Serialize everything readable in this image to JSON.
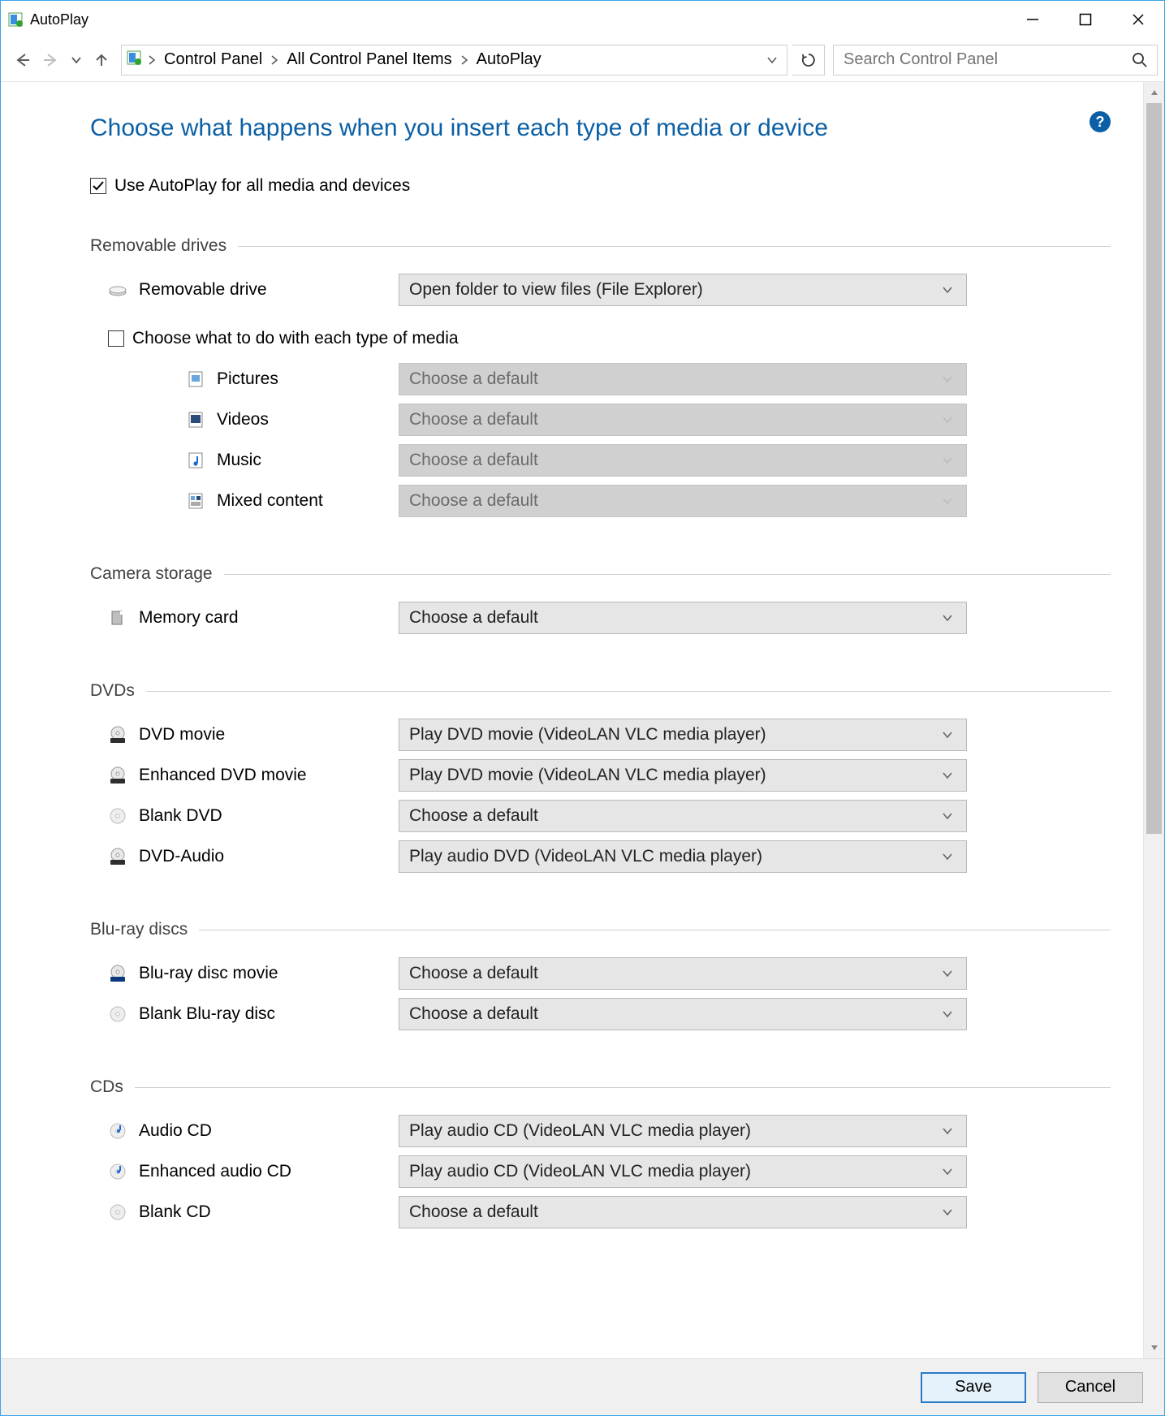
{
  "window": {
    "title": "AutoPlay"
  },
  "breadcrumb": {
    "items": [
      "Control Panel",
      "All Control Panel Items",
      "AutoPlay"
    ]
  },
  "search": {
    "placeholder": "Search Control Panel"
  },
  "page": {
    "title": "Choose what happens when you insert each type of media or device",
    "help_tooltip": "?"
  },
  "checkboxes": {
    "use_autoplay": {
      "label": "Use AutoPlay for all media and devices",
      "checked": true
    },
    "each_type": {
      "label": "Choose what to do with each type of media",
      "checked": false
    }
  },
  "dropdown_values": {
    "open_folder": "Open folder to view files (File Explorer)",
    "choose_default": "Choose a default",
    "play_dvd": "Play DVD movie (VideoLAN VLC media player)",
    "play_audio_dvd": "Play audio DVD (VideoLAN VLC media player)",
    "play_audio_cd": "Play audio CD (VideoLAN VLC media player)"
  },
  "sections": {
    "removable": {
      "title": "Removable drives",
      "main": {
        "label": "Removable drive",
        "value_key": "open_folder"
      },
      "subs": [
        {
          "label": "Pictures",
          "value_key": "choose_default",
          "disabled": true
        },
        {
          "label": "Videos",
          "value_key": "choose_default",
          "disabled": true
        },
        {
          "label": "Music",
          "value_key": "choose_default",
          "disabled": true
        },
        {
          "label": "Mixed content",
          "value_key": "choose_default",
          "disabled": true
        }
      ]
    },
    "camera": {
      "title": "Camera storage",
      "items": [
        {
          "label": "Memory card",
          "value_key": "choose_default"
        }
      ]
    },
    "dvds": {
      "title": "DVDs",
      "items": [
        {
          "label": "DVD movie",
          "value_key": "play_dvd"
        },
        {
          "label": "Enhanced DVD movie",
          "value_key": "play_dvd"
        },
        {
          "label": "Blank DVD",
          "value_key": "choose_default"
        },
        {
          "label": "DVD-Audio",
          "value_key": "play_audio_dvd"
        }
      ]
    },
    "bluray": {
      "title": "Blu-ray discs",
      "items": [
        {
          "label": "Blu-ray disc movie",
          "value_key": "choose_default"
        },
        {
          "label": "Blank Blu-ray disc",
          "value_key": "choose_default"
        }
      ]
    },
    "cds": {
      "title": "CDs",
      "items": [
        {
          "label": "Audio CD",
          "value_key": "play_audio_cd"
        },
        {
          "label": "Enhanced audio CD",
          "value_key": "play_audio_cd"
        },
        {
          "label": "Blank CD",
          "value_key": "choose_default"
        }
      ]
    }
  },
  "buttons": {
    "save": "Save",
    "cancel": "Cancel"
  }
}
